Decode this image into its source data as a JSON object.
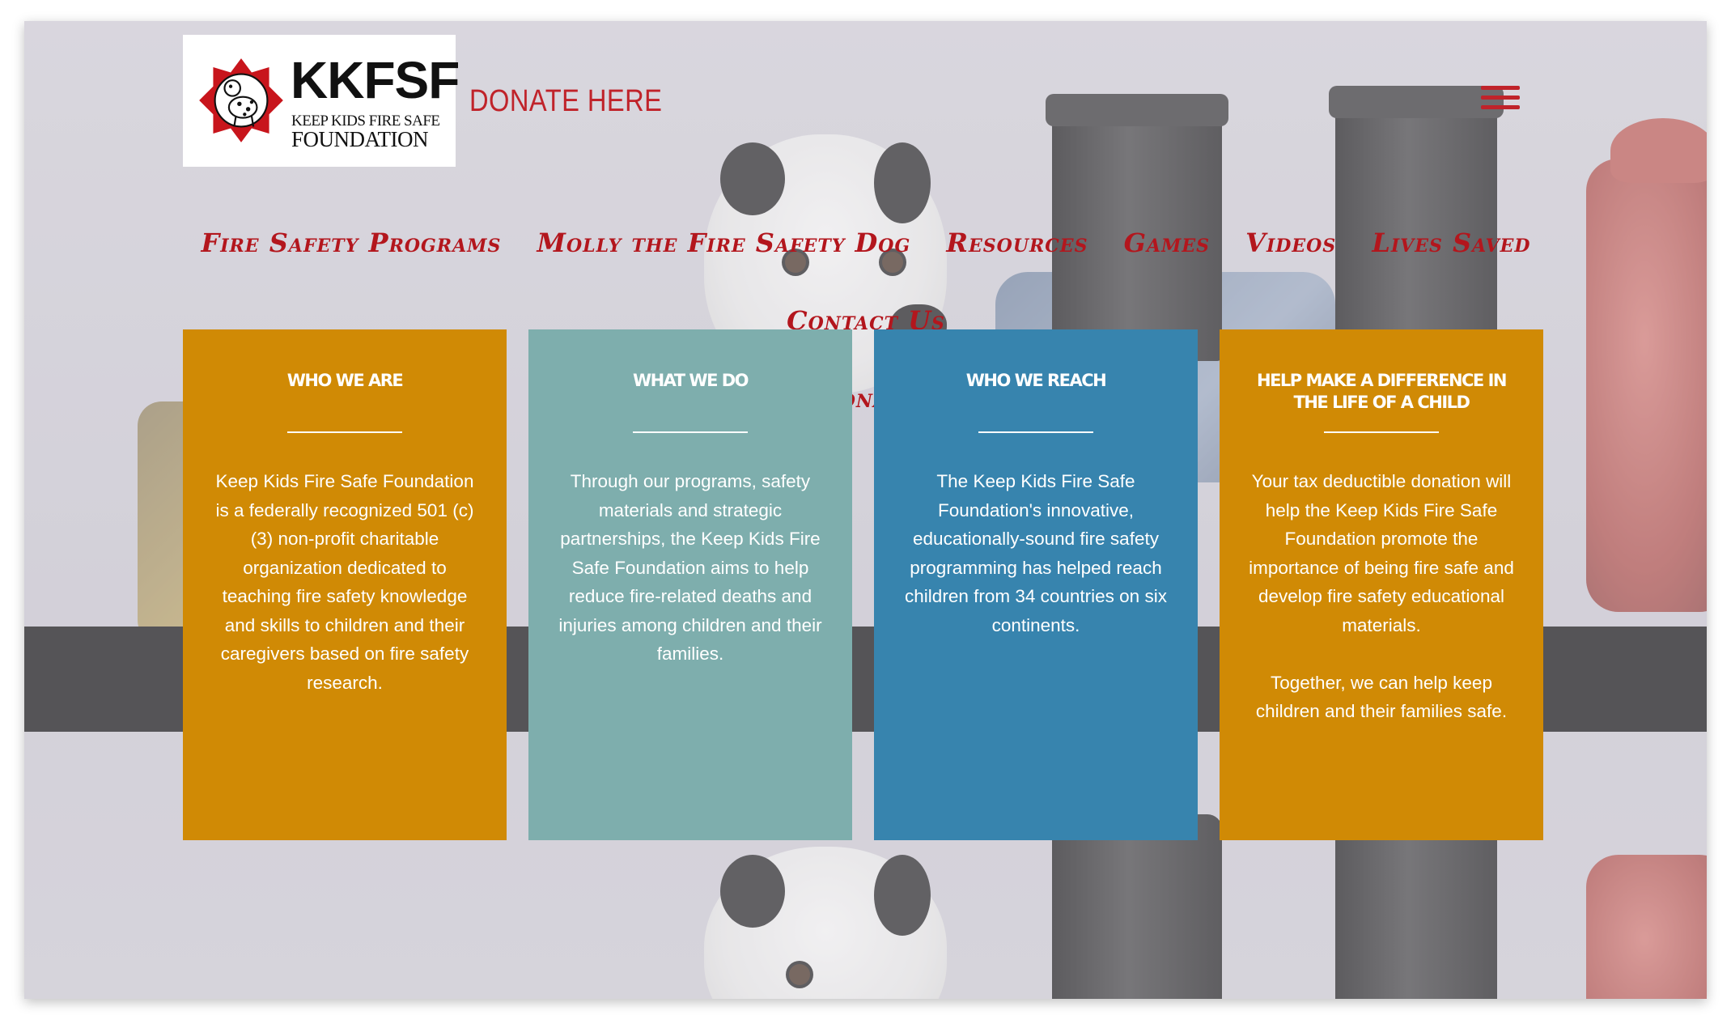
{
  "header": {
    "logo": {
      "title": "KKFSF",
      "subtitle_line1": "KEEP KIDS FIRE SAFE",
      "subtitle_line2": "FOUNDATION"
    },
    "donate_link": "DONATE HERE",
    "menu_icon": "hamburger-menu-icon"
  },
  "nav": {
    "items": [
      "Fire Safety Programs",
      "Molly the Fire Safety Dog",
      "Resources",
      "Games",
      "Videos",
      "Lives Saved",
      "Contact Us",
      "Donate"
    ]
  },
  "cards": [
    {
      "title": "WHO WE ARE",
      "body": "Keep Kids Fire Safe Foundation is a federally recognized 501 (c)(3) non-profit charitable organization dedicated to teaching fire safety knowledge and skills to children and their caregivers based on fire safety research."
    },
    {
      "title": "WHAT WE DO",
      "body": "Through our programs, safety materials and strategic partnerships, the Keep Kids Fire Safe Foundation aims to help reduce fire-related deaths and injuries among children and their families."
    },
    {
      "title": "WHO WE REACH",
      "body": "The Keep Kids Fire Safe Foundation's innovative, educationally-sound fire safety programming has helped reach children from 34 countries on six continents."
    },
    {
      "title": "HELP MAKE A DIFFERENCE IN THE LIFE OF A CHILD",
      "body": "Your tax deductible donation will help the Keep Kids Fire Safe Foundation promote the importance of being fire safe and develop fire safety educational materials.\n\nTogether, we can help keep children and their families safe."
    }
  ],
  "colors": {
    "accent_red": "#c0232a",
    "card_orange": "#d08a05",
    "card_teal": "#7eaead",
    "card_blue": "#3784ae"
  }
}
